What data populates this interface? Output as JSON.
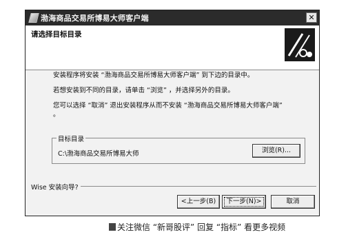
{
  "window": {
    "title": "渤海商品交易所博易大师客户端",
    "close_glyph": "✕"
  },
  "header": {
    "title": "请选择目标目录",
    "logo_icon": "wise-installer-logo"
  },
  "body": {
    "line1": "安装程序将安装 “渤海商品交易所博易大师客户端” 到下边的目录中。",
    "line2": "若想安装到不同的目录，请单击 “浏览” ，并选择另外的目录。",
    "line3": "您可以选择 “取消” 退出安装程序从而不安装 “渤海商品交易所博易大师客户端”",
    "line3_cont": "。"
  },
  "destination": {
    "legend": "目标目录",
    "path": "C:\\渤海商品交易所博易大师",
    "browse_label": "浏览(R)..."
  },
  "footer": {
    "wizard_label": "Wise 安装向导?",
    "back_label": "<上一步(B)",
    "next_label": "下一步(N)>",
    "cancel_label": "取消"
  },
  "caption": {
    "text": "关注微信 “新哥股评” 回复 “指标” 看更多视频"
  }
}
